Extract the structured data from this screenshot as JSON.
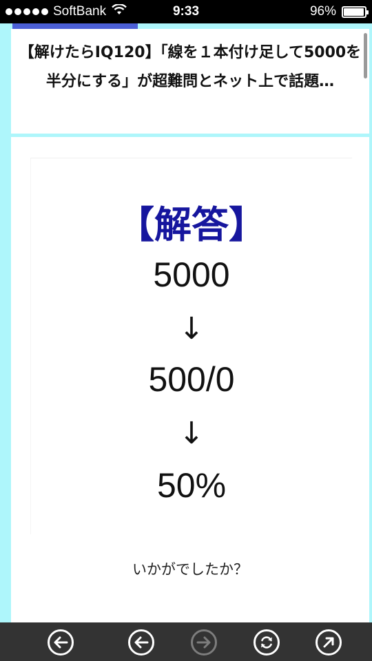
{
  "status_bar": {
    "carrier": "SoftBank",
    "time": "9:33",
    "battery": "96%"
  },
  "article": {
    "title": "【解けたらIQ120】「線を１本付け足して5000を半分にする」が超難問とネット上で話題…",
    "answer": {
      "heading": "【解答】",
      "lines": [
        "5000",
        "↓",
        "500/0",
        "↓",
        "50%"
      ]
    },
    "closing": "いかがでしたか？"
  },
  "toolbar": {
    "buttons": [
      {
        "name": "back-first-button",
        "icon": "arrow-left-circle-icon",
        "enabled": true
      },
      {
        "name": "back-button",
        "icon": "arrow-left-circle-icon",
        "enabled": true
      },
      {
        "name": "forward-button",
        "icon": "arrow-right-circle-icon",
        "enabled": false
      },
      {
        "name": "reload-button",
        "icon": "refresh-icon",
        "enabled": true
      },
      {
        "name": "open-external-button",
        "icon": "arrow-up-right-icon",
        "enabled": true
      }
    ]
  },
  "colors": {
    "background": "#aef6fb",
    "heading_blue": "#16169e",
    "toolbar": "#333333"
  }
}
